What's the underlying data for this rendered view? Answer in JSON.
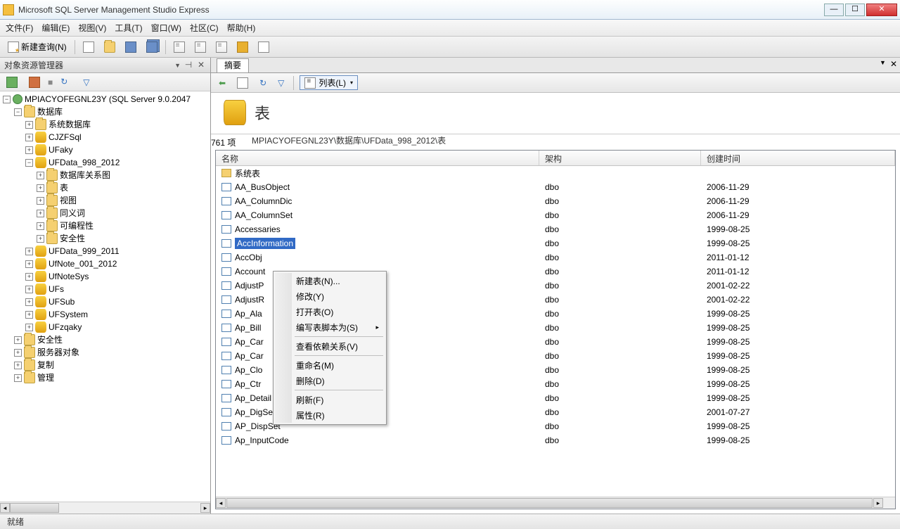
{
  "window": {
    "title": "Microsoft SQL Server Management Studio Express"
  },
  "menu": {
    "file": "文件(F)",
    "edit": "编辑(E)",
    "view": "视图(V)",
    "tools": "工具(T)",
    "window": "窗口(W)",
    "community": "社区(C)",
    "help": "帮助(H)"
  },
  "toolbar": {
    "new_query": "新建查询(N)"
  },
  "object_explorer": {
    "title": "对象资源管理器",
    "server": "MPIACYOFEGNL23Y (SQL Server 9.0.2047",
    "databases": "数据库",
    "sys_db": "系统数据库",
    "db1": "CJZFSql",
    "db2": "UFaky",
    "db3": "UFData_998_2012",
    "db3_diagram": "数据库关系图",
    "db3_tables": "表",
    "db3_views": "视图",
    "db3_synonyms": "同义词",
    "db3_programmability": "可编程性",
    "db3_security": "安全性",
    "db4": "UFData_999_2011",
    "db5": "UfNote_001_2012",
    "db6": "UfNoteSys",
    "db7": "UFs",
    "db8": "UFSub",
    "db9": "UFSystem",
    "db10": "UFzqaky",
    "security": "安全性",
    "server_objects": "服务器对象",
    "replication": "复制",
    "management": "管理"
  },
  "summary": {
    "tab": "摘要",
    "list_btn": "列表(L)",
    "title": "表",
    "path": "MPIACYOFEGNL23Y\\数据库\\UFData_998_2012\\表",
    "count": "761 项",
    "col_name": "名称",
    "col_schema": "架构",
    "col_date": "创建时间",
    "sys_tables": "系统表"
  },
  "tables": [
    {
      "name": "AA_BusObject",
      "schema": "dbo",
      "date": "2006-11-29"
    },
    {
      "name": "AA_ColumnDic",
      "schema": "dbo",
      "date": "2006-11-29"
    },
    {
      "name": "AA_ColumnSet",
      "schema": "dbo",
      "date": "2006-11-29"
    },
    {
      "name": "Accessaries",
      "schema": "dbo",
      "date": "1999-08-25"
    },
    {
      "name": "AccInformation",
      "schema": "dbo",
      "date": "1999-08-25",
      "selected": true
    },
    {
      "name": "AccObj",
      "schema": "dbo",
      "date": "2011-01-12"
    },
    {
      "name": "Account",
      "schema": "dbo",
      "date": "2011-01-12"
    },
    {
      "name": "AdjustP",
      "schema": "dbo",
      "date": "2001-02-22"
    },
    {
      "name": "AdjustR",
      "schema": "dbo",
      "date": "2001-02-22"
    },
    {
      "name": "Ap_Ala",
      "schema": "dbo",
      "date": "1999-08-25"
    },
    {
      "name": "Ap_Bill",
      "schema": "dbo",
      "date": "1999-08-25"
    },
    {
      "name": "Ap_Car",
      "schema": "dbo",
      "date": "1999-08-25"
    },
    {
      "name": "Ap_Car",
      "schema": "dbo",
      "date": "1999-08-25"
    },
    {
      "name": "Ap_Clo",
      "schema": "dbo",
      "date": "1999-08-25"
    },
    {
      "name": "Ap_Ctr",
      "schema": "dbo",
      "date": "1999-08-25"
    },
    {
      "name": "Ap_Detail",
      "schema": "dbo",
      "date": "1999-08-25"
    },
    {
      "name": "Ap_DigSet",
      "schema": "dbo",
      "date": "2001-07-27"
    },
    {
      "name": "AP_DispSet",
      "schema": "dbo",
      "date": "1999-08-25"
    },
    {
      "name": "Ap_InputCode",
      "schema": "dbo",
      "date": "1999-08-25"
    }
  ],
  "context_menu": {
    "new_table": "新建表(N)...",
    "modify": "修改(Y)",
    "open_table": "打开表(O)",
    "script_as": "编写表脚本为(S)",
    "view_deps": "查看依赖关系(V)",
    "rename": "重命名(M)",
    "delete": "删除(D)",
    "refresh": "刷新(F)",
    "properties": "属性(R)"
  },
  "statusbar": {
    "ready": "就绪"
  }
}
